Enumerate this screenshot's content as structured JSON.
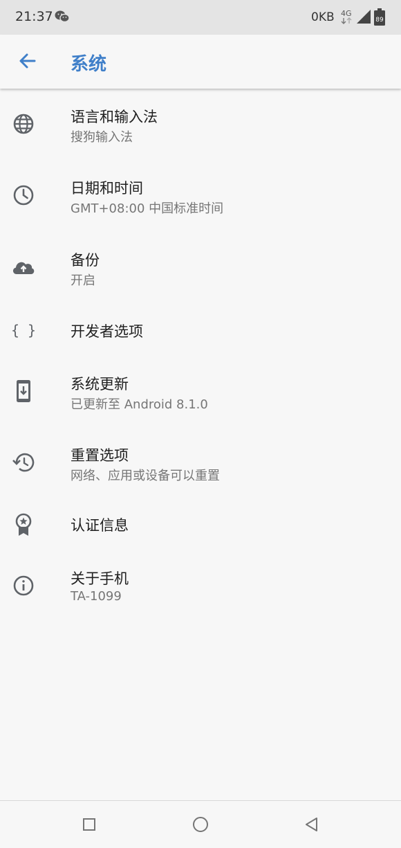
{
  "status_bar": {
    "time": "21:37",
    "net_speed": "0KB",
    "net_type": "4G",
    "battery_level": "89"
  },
  "app_bar": {
    "title": "系统"
  },
  "items": [
    {
      "icon": "globe-icon",
      "title": "语言和输入法",
      "subtitle": "搜狗输入法"
    },
    {
      "icon": "clock-icon",
      "title": "日期和时间",
      "subtitle": "GMT+08:00 中国标准时间"
    },
    {
      "icon": "cloud-upload-icon",
      "title": "备份",
      "subtitle": "开启"
    },
    {
      "icon": "code-braces-icon",
      "title": "开发者选项",
      "subtitle": ""
    },
    {
      "icon": "system-update-icon",
      "title": "系统更新",
      "subtitle": "已更新至 Android 8.1.0"
    },
    {
      "icon": "history-icon",
      "title": "重置选项",
      "subtitle": "网络、应用或设备可以重置"
    },
    {
      "icon": "certificate-icon",
      "title": "认证信息",
      "subtitle": ""
    },
    {
      "icon": "info-icon",
      "title": "关于手机",
      "subtitle": "TA-1099"
    }
  ],
  "colors": {
    "accent": "#3f7fc9",
    "background": "#f7f7f7",
    "status_bar": "#e4e4e4",
    "icon": "#5f6368"
  }
}
